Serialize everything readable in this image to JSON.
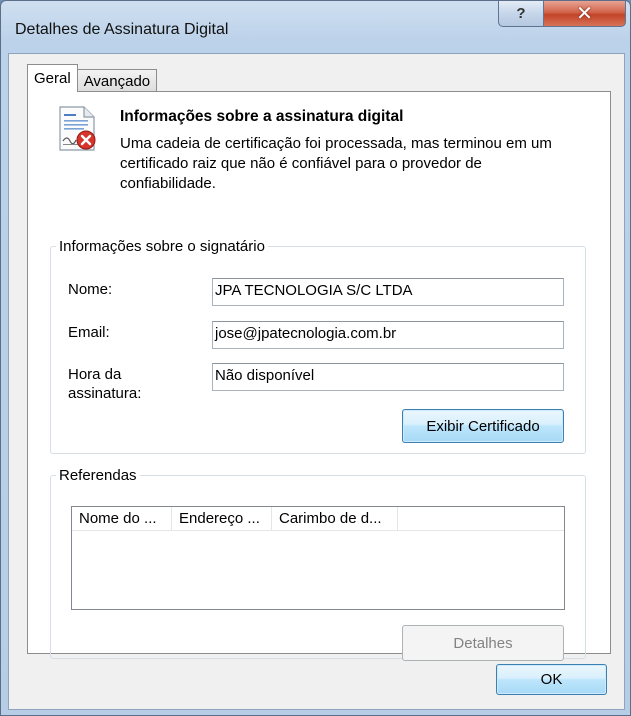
{
  "window": {
    "title": "Detalhes de Assinatura Digital",
    "help_glyph": "?",
    "close_glyph": "✕"
  },
  "tabs": [
    {
      "label": "Geral",
      "active": true
    },
    {
      "label": "Avançado",
      "active": false
    }
  ],
  "info": {
    "icon": "certificate-error-icon",
    "title": "Informações sobre a assinatura digital",
    "description": "Uma cadeia de certificação foi processada, mas terminou em um certificado raiz que não é confiável para o provedor de confiabilidade."
  },
  "signer": {
    "legend": "Informações sobre o signatário",
    "name_label": "Nome:",
    "name_value": "JPA TECNOLOGIA S/C LTDA",
    "email_label": "Email:",
    "email_value": "jose@jpatecnologia.com.br",
    "time_label_line1": "Hora da",
    "time_label_line2": "assinatura:",
    "time_value": "Não disponível",
    "view_cert_button": "Exibir Certificado"
  },
  "references": {
    "legend": "Referendas",
    "columns": [
      "Nome do ...",
      "Endereço ...",
      "Carimbo de d..."
    ],
    "rows": [],
    "details_button": "Detalhes"
  },
  "footer": {
    "ok_button": "OK"
  }
}
